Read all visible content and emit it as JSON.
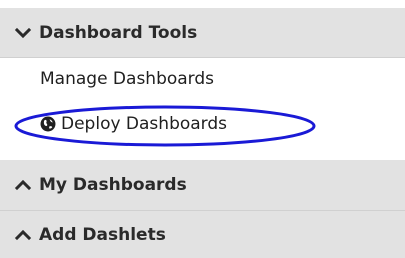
{
  "sections": [
    {
      "label": "Dashboard Tools",
      "state": "expanded",
      "icon": "chevron-down-icon"
    },
    {
      "label": "My Dashboards",
      "state": "collapsed",
      "icon": "chevron-up-icon"
    },
    {
      "label": "Add Dashlets",
      "state": "collapsed",
      "icon": "chevron-up-icon"
    }
  ],
  "dashboard_tools": {
    "items": [
      {
        "label": "Manage Dashboards"
      },
      {
        "label": "Deploy Dashboards",
        "icon": "globe-icon"
      }
    ]
  },
  "colors": {
    "header_bg": "#e2e2e2",
    "header_text": "#2a2a2a",
    "item_text": "#1f1f1f",
    "highlight_ellipse": "#1a1ad6"
  }
}
